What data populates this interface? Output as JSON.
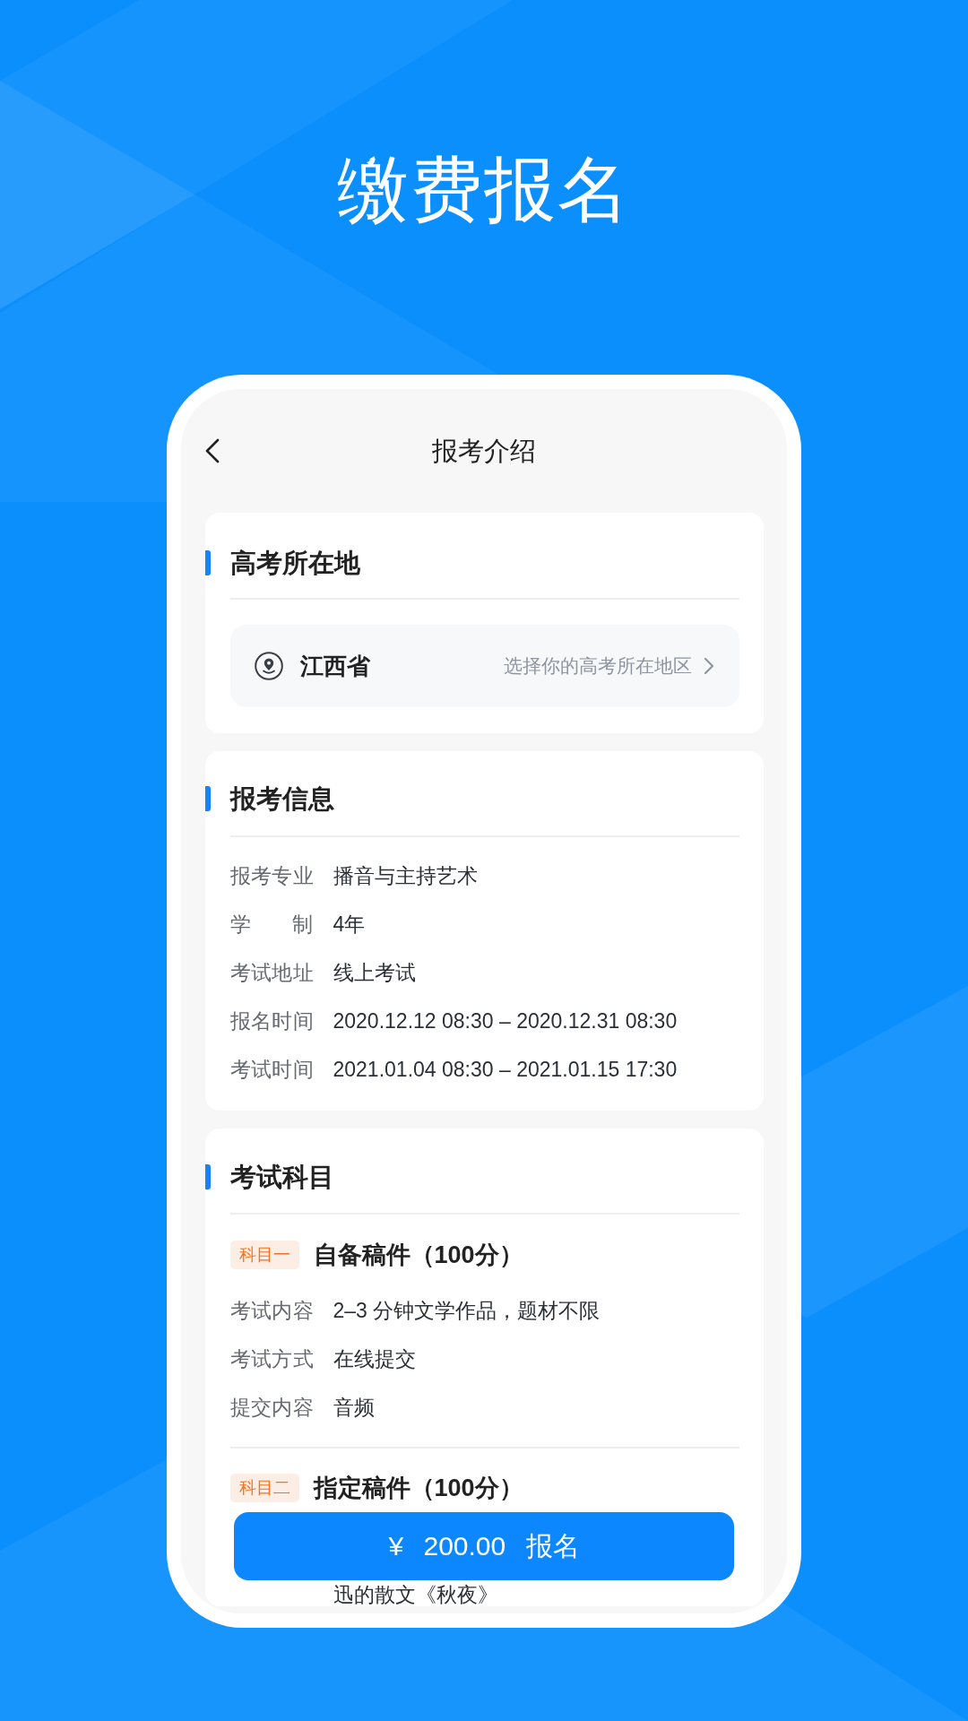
{
  "page_title": "缴费报名",
  "nav": {
    "title": "报考介绍"
  },
  "location_section": {
    "title": "高考所在地",
    "province": "江西省",
    "hint": "选择你的高考所在地区"
  },
  "info_section": {
    "title": "报考信息",
    "rows": [
      {
        "label": "报考专业",
        "value": "播音与主持艺术"
      },
      {
        "label": "学 制",
        "value": "4年"
      },
      {
        "label": "考试地址",
        "value": "线上考试"
      },
      {
        "label": "报名时间",
        "value": "2020.12.12 08:30 – 2020.12.31 08:30"
      },
      {
        "label": "考试时间",
        "value": "2021.01.04 08:30 – 2021.01.15 17:30"
      }
    ]
  },
  "subjects_section": {
    "title": "考试科目",
    "subjects": [
      {
        "tag": "科目一",
        "title": "自备稿件（100分）",
        "rows": [
          {
            "label": "考试内容",
            "value": "2–3 分钟文学作品，题材不限"
          },
          {
            "label": "考试方式",
            "value": "在线提交"
          },
          {
            "label": "提交内容",
            "value": "音频"
          }
        ]
      },
      {
        "tag": "科目二",
        "title": "指定稿件（100分）",
        "rows": [
          {
            "value": "迅的散文《秋夜》"
          }
        ]
      }
    ]
  },
  "pay_button": {
    "label": "¥ 200.00 报名"
  }
}
